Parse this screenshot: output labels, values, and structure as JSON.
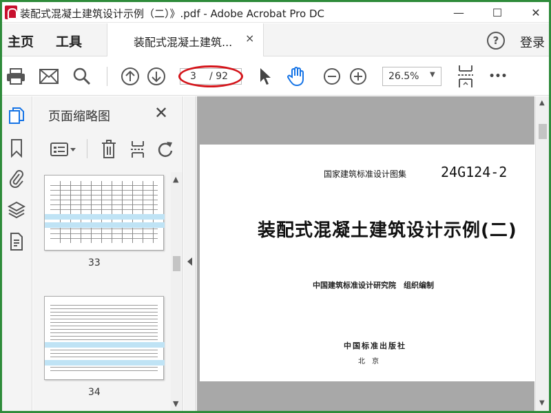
{
  "window": {
    "title": "装配式混凝土建筑设计示例（二）》.pdf - Adobe Acrobat Pro DC",
    "minimize_glyph": "—",
    "maximize_glyph": "☐",
    "close_glyph": "✕"
  },
  "tabs": {
    "home": "主页",
    "tools": "工具",
    "document_tab": "装配式混凝土建筑...",
    "document_tab_close": "×",
    "help": "?",
    "login": "登录"
  },
  "toolbar": {
    "current_page": "3",
    "total_pages": "/ 92",
    "zoom": "26.5%",
    "zoom_arrow": "▼",
    "more": "•••"
  },
  "sidebar": {
    "panel_title": "页面缩略图",
    "panel_close": "✕",
    "thumbnails": [
      {
        "page_label": "33"
      },
      {
        "page_label": "34"
      }
    ]
  },
  "document": {
    "series": "国家建筑标准设计图集",
    "code": "24G124-2",
    "title": "装配式混凝土建筑设计示例(二)",
    "organization": "中国建筑标准设计研究院　组织编制",
    "publisher": "中国标准出版社",
    "city": "北京"
  },
  "colors": {
    "accent_blue": "#1473e6",
    "annotation_red": "#d4141a",
    "window_border": "#2e8b3a",
    "pdf_icon": "#c8102e"
  }
}
